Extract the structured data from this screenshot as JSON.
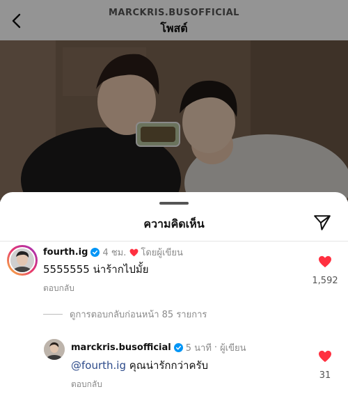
{
  "header": {
    "username": "MARCKRIS.BUSOFFICIAL",
    "title": "โพสต์",
    "back_icon": "chevron-left-icon"
  },
  "sheet": {
    "title": "ความคิดเห็น",
    "share_icon": "paper-plane-icon"
  },
  "comments": [
    {
      "username": "fourth.ig",
      "verified": true,
      "time": "4 ชม.",
      "liked_by_author": "โดยผู้เขียน",
      "text": "5555555 น่าร้ากไปมั้ย",
      "reply_label": "ตอบกลับ",
      "likes": "1,592",
      "view_replies": "ดูการตอบกลับก่อนหน้า 85 รายการ"
    },
    {
      "username": "marckris.busofficial",
      "verified": true,
      "time": "5 นาที",
      "separator": "·",
      "author_label": "ผู้เขียน",
      "mention": "@fourth.ig",
      "text": " คุณน่ารักกว่าครับ",
      "reply_label": "ตอบกลับ",
      "likes": "31"
    }
  ],
  "colors": {
    "like_red": "#ff3040",
    "verified_blue": "#0095f6",
    "mention_blue": "#2c4a8a"
  }
}
